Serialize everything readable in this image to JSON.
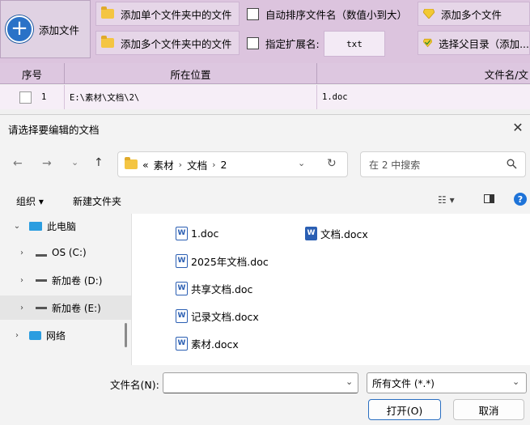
{
  "toolbar": {
    "add_file": "添加文件",
    "add_single_folder": "添加单个文件夹中的文件",
    "add_multi_folder": "添加多个文件夹中的文件",
    "auto_sort": "自动排序文件名（数值小到大）",
    "specify_ext": "指定扩展名:",
    "ext_value": "txt",
    "add_multi_file": "添加多个文件",
    "choose_parent": "选择父目录（添加..."
  },
  "table": {
    "headers": [
      "序号",
      "所在位置",
      "文件名/文"
    ],
    "rows": [
      {
        "index": "1",
        "location": "E:\\素材\\文档\\2\\",
        "filename": "1.doc"
      }
    ]
  },
  "dialog": {
    "title": "请选择要编辑的文档",
    "path": {
      "overflow": "«",
      "segments": [
        "素材",
        "文档",
        "2"
      ]
    },
    "search_placeholder": "在 2 中搜索",
    "organize": "组织 ▾",
    "new_folder": "新建文件夹",
    "tree": [
      {
        "label": "此电脑",
        "expanded": true
      },
      {
        "label": "OS (C:)"
      },
      {
        "label": "新加卷 (D:)"
      },
      {
        "label": "新加卷 (E:)",
        "selected": true
      },
      {
        "label": "网络"
      }
    ],
    "files_col1": [
      "1.doc",
      "2025年文档.doc",
      "共享文档.doc",
      "记录文档.docx",
      "素材.docx"
    ],
    "files_col2": [
      "文档.docx"
    ],
    "filename_label": "文件名(N):",
    "filename_value": "",
    "filter_value": "所有文件 (*.*)",
    "open_label": "打开(O)",
    "cancel_label": "取消"
  },
  "colors": {
    "toolbar_bg": "#dcc4de",
    "accent": "#2a72c7",
    "word_blue": "#2b5fb3"
  }
}
